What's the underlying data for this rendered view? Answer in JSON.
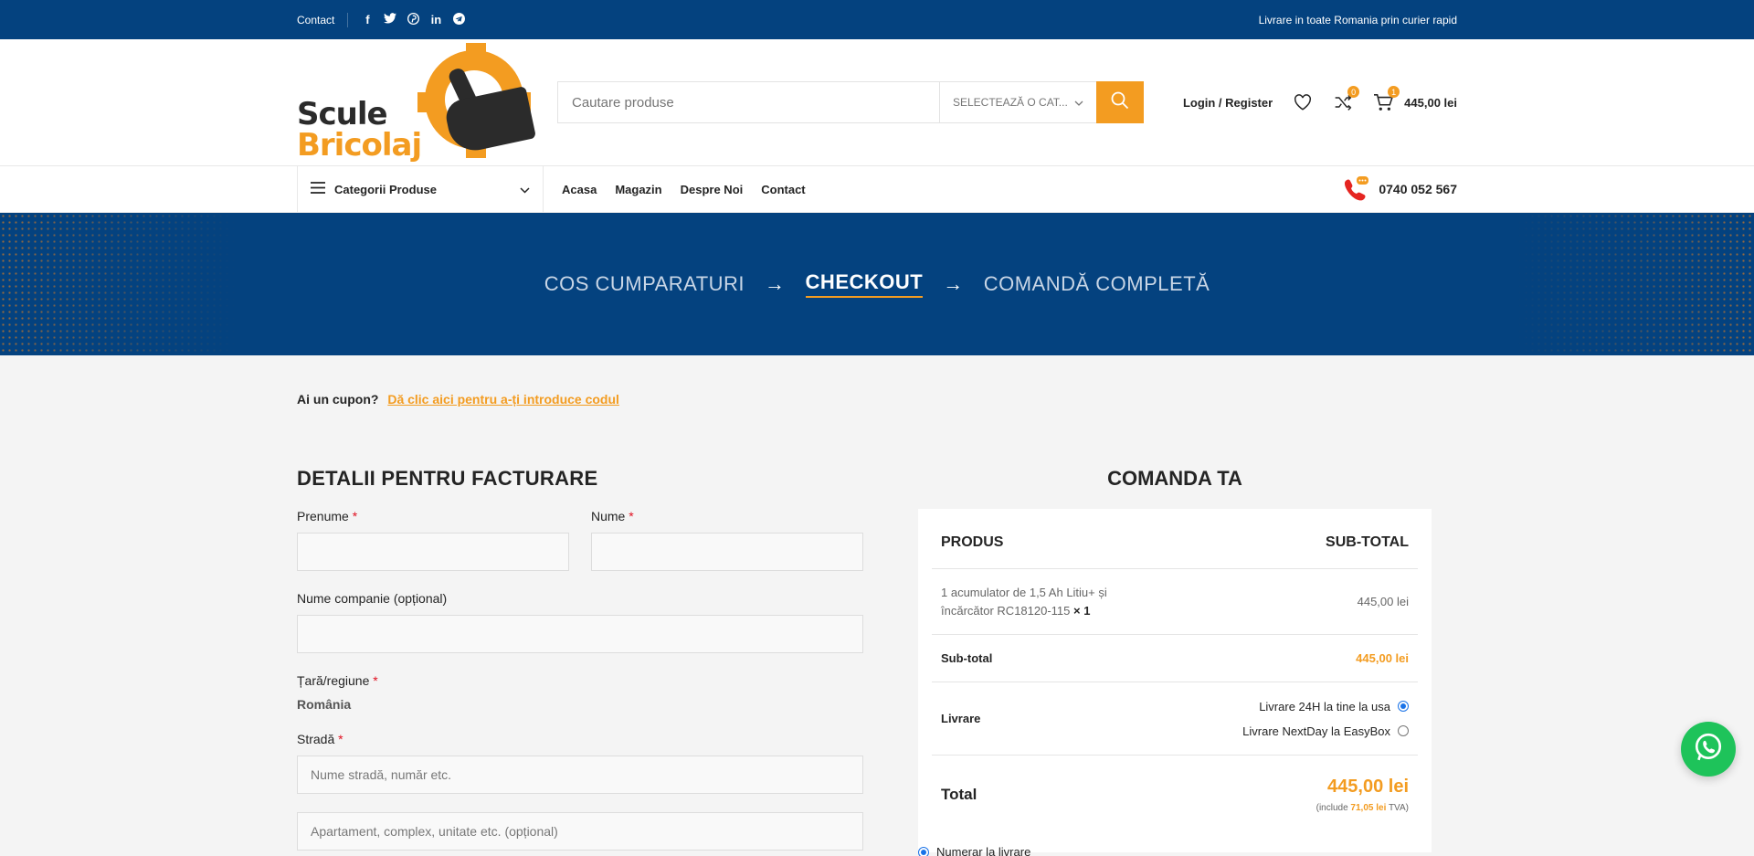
{
  "topbar": {
    "contact": "Contact",
    "social": [
      "f",
      "t",
      "p",
      "in",
      "tg"
    ],
    "shipping_note": "Livrare in toate Romania prin curier rapid"
  },
  "logo": {
    "line1": "Scule",
    "line2": "Bricolaj"
  },
  "search": {
    "placeholder": "Cautare produse",
    "category": "SELECTEAZĂ O CAT..."
  },
  "account": {
    "login": "Login / Register",
    "compare_count": "0",
    "cart_count": "1",
    "cart_total": "445,00 lei"
  },
  "nav": {
    "categories": "Categorii Produse",
    "items": [
      "Acasa",
      "Magazin",
      "Despre Noi",
      "Contact"
    ],
    "phone": "0740 052 567"
  },
  "steps": {
    "step1": "COS CUMPARATURI",
    "step2": "CHECKOUT",
    "step3": "COMANDĂ COMPLETĂ",
    "arrow": "→"
  },
  "coupon": {
    "question": "Ai un cupon?",
    "link": "Dă clic aici pentru a-ți introduce codul"
  },
  "billing": {
    "title": "DETALII PENTRU FACTURARE",
    "first_name": "Prenume",
    "last_name": "Nume",
    "company": "Nume companie (opțional)",
    "country_label": "Țară/regiune",
    "country_value": "România",
    "street_label": "Stradă",
    "street_placeholder": "Nume stradă, număr etc.",
    "apartment_placeholder": "Apartament, complex, unitate etc. (opțional)",
    "required": "*"
  },
  "order": {
    "title": "COMANDA TA",
    "col_product": "PRODUS",
    "col_subtotal": "SUB-TOTAL",
    "item_name_l1": "1 acumulator de 1,5 Ah Litiu+ și",
    "item_name_l2": "încărcător RC18120-115",
    "item_qty": "× 1",
    "item_price": "445,00 lei",
    "subtotal_label": "Sub-total",
    "subtotal_value": "445,00 lei",
    "shipping_label": "Livrare",
    "shipping_option_1": "Livrare 24H la tine la usa",
    "shipping_option_2": "Livrare NextDay la EasyBox",
    "total_label": "Total",
    "total_value": "445,00 lei",
    "vat_prefix": "(include",
    "vat_value": "71,05 lei",
    "vat_suffix": "TVA)",
    "payment_method": "Numerar la livrare"
  },
  "colors": {
    "primary": "#04427f",
    "accent": "#f39c21",
    "whatsapp": "#1ec35a"
  }
}
